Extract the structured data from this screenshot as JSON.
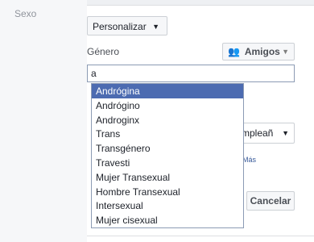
{
  "row_label": "Sexo",
  "sex_select": {
    "value": "Personalizar"
  },
  "gender_label": "Género",
  "audience_button": {
    "label": "Amigos"
  },
  "gender_input": {
    "value": "a"
  },
  "suggestions": [
    "Andrógina",
    "Andrógino",
    "Androginx",
    "Trans",
    "Transgénero",
    "Travesti",
    "Mujer Transexual",
    "Hombre Transexual",
    "Intersexual",
    "Mujer cisexual"
  ],
  "hidden_select": {
    "value": "mpleañ"
  },
  "more_link": "Más",
  "cancel_button": "Cancelar",
  "colors": {
    "highlight": "#4c6bb1",
    "link": "#365899"
  }
}
